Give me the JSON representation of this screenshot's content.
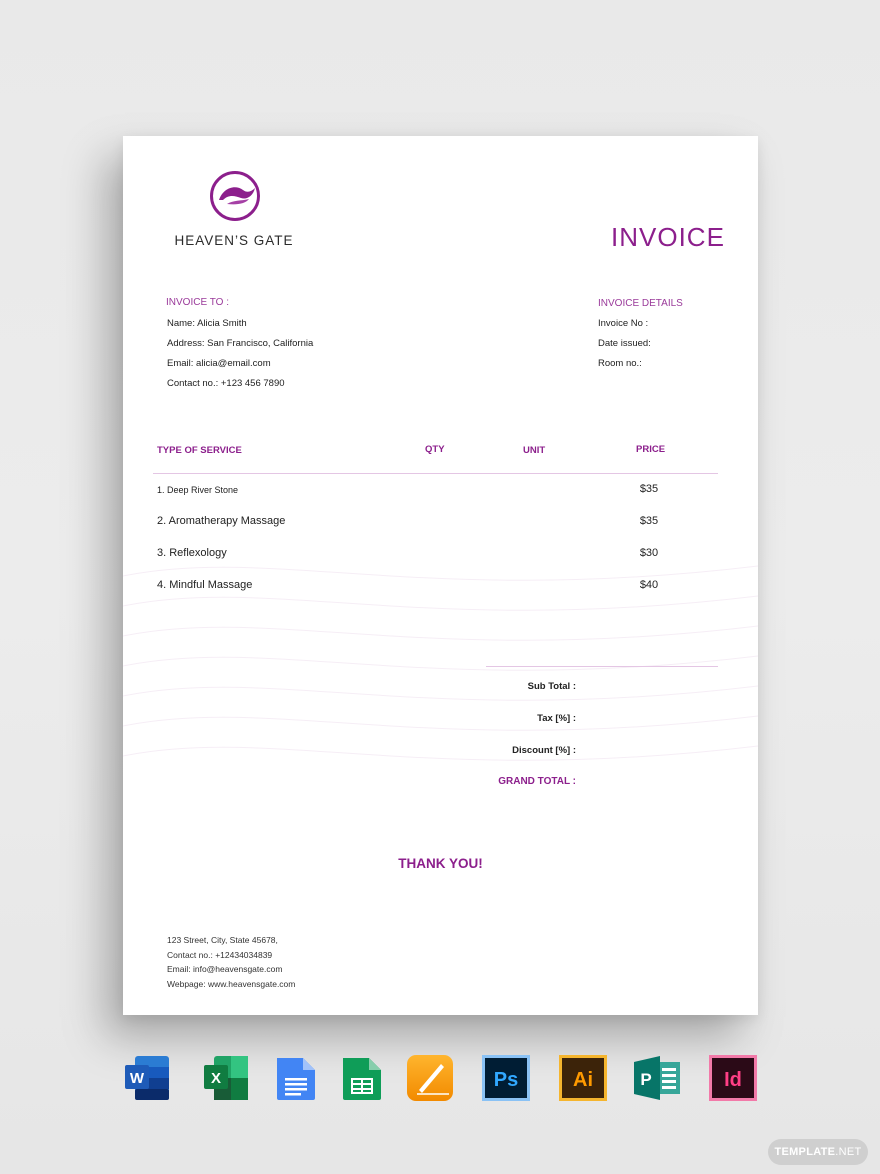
{
  "document": {
    "brand_name": "HEAVEN’S GATE",
    "title": "INVOICE",
    "invoice_to": {
      "heading": "INVOICE TO :",
      "lines": [
        "Name: Alicia Smith",
        "Address: San Francisco, California",
        "Email: alicia@email.com",
        "Contact no.: +123 456 7890"
      ]
    },
    "invoice_details": {
      "heading": "INVOICE DETAILS",
      "lines": [
        "Invoice No :",
        "Date issued:",
        "Room no.:"
      ]
    },
    "table": {
      "headers": [
        "TYPE OF SERVICE",
        "QTY",
        "UNIT",
        "PRICE"
      ],
      "rows": [
        {
          "service": "1. Deep River Stone",
          "qty": "",
          "unit": "",
          "price": "$35"
        },
        {
          "service": "2. Aromatherapy Massage",
          "qty": "",
          "unit": "",
          "price": "$35"
        },
        {
          "service": "3. Reflexology",
          "qty": "",
          "unit": "",
          "price": "$30"
        },
        {
          "service": "4. Mindful Massage",
          "qty": "",
          "unit": "",
          "price": "$40"
        }
      ]
    },
    "totals": {
      "sub_total": "Sub Total :",
      "tax": "Tax [%] :",
      "discount": "Discount [%] :",
      "grand_total": "GRAND TOTAL :"
    },
    "thank_you": "THANK YOU!",
    "footer": [
      "123 Street, City, State 45678,",
      "Contact no.: +12434034839",
      "Email: info@heavensgate.com",
      "Webpage: www.heavensgate.com"
    ]
  },
  "app_icons": [
    {
      "name": "word-icon",
      "label": "W"
    },
    {
      "name": "excel-icon",
      "label": "X"
    },
    {
      "name": "google-docs-icon",
      "label": ""
    },
    {
      "name": "google-sheets-icon",
      "label": ""
    },
    {
      "name": "pages-icon",
      "label": ""
    },
    {
      "name": "photoshop-icon",
      "label": "Ps"
    },
    {
      "name": "illustrator-icon",
      "label": "Ai"
    },
    {
      "name": "publisher-icon",
      "label": "P"
    },
    {
      "name": "indesign-icon",
      "label": "Id"
    }
  ],
  "watermark": {
    "bold": "TEMPLATE",
    "light": ".NET"
  },
  "colors": {
    "accent": "#8c1f8c",
    "rule": "#e4c6e4"
  }
}
